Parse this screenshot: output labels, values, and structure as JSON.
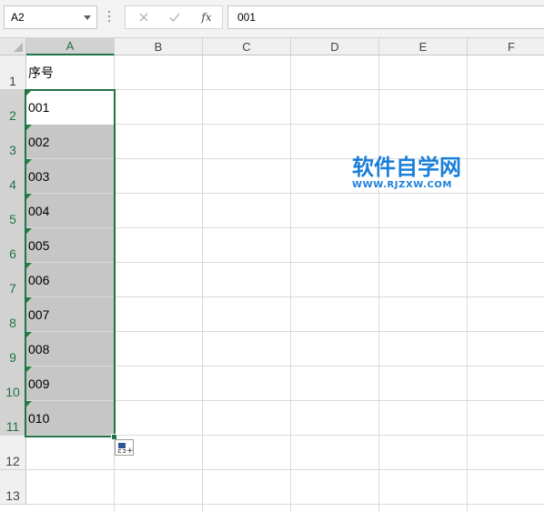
{
  "formula_bar": {
    "name_box": "A2",
    "cancel_symbol": "✕",
    "enter_symbol": "✓",
    "fx_label": "fx",
    "formula_value": "001"
  },
  "columns": [
    "A",
    "B",
    "C",
    "D",
    "E",
    "F"
  ],
  "rows": [
    "1",
    "2",
    "3",
    "4",
    "5",
    "6",
    "7",
    "8",
    "9",
    "10",
    "11",
    "12",
    "13"
  ],
  "cells": {
    "A1": "序号",
    "A2": "001",
    "A3": "002",
    "A4": "003",
    "A5": "004",
    "A6": "005",
    "A7": "006",
    "A8": "007",
    "A9": "008",
    "A10": "009",
    "A11": "010"
  },
  "selection": {
    "active_cell": "A2",
    "range": "A2:A11"
  },
  "watermark": {
    "title": "软件自学网",
    "url": "WWW.RJZXW.COM",
    "color": "#1a7fd8"
  },
  "colors": {
    "accent": "#217346",
    "selection_fill": "#c6c6c6",
    "error_indicator": "#1e7f3e"
  },
  "icons": {
    "name_box_dropdown": "chevron-down-icon",
    "cancel": "close-icon",
    "enter": "check-icon",
    "insert_function": "fx-icon",
    "quick_analysis": "paste-options-icon"
  }
}
